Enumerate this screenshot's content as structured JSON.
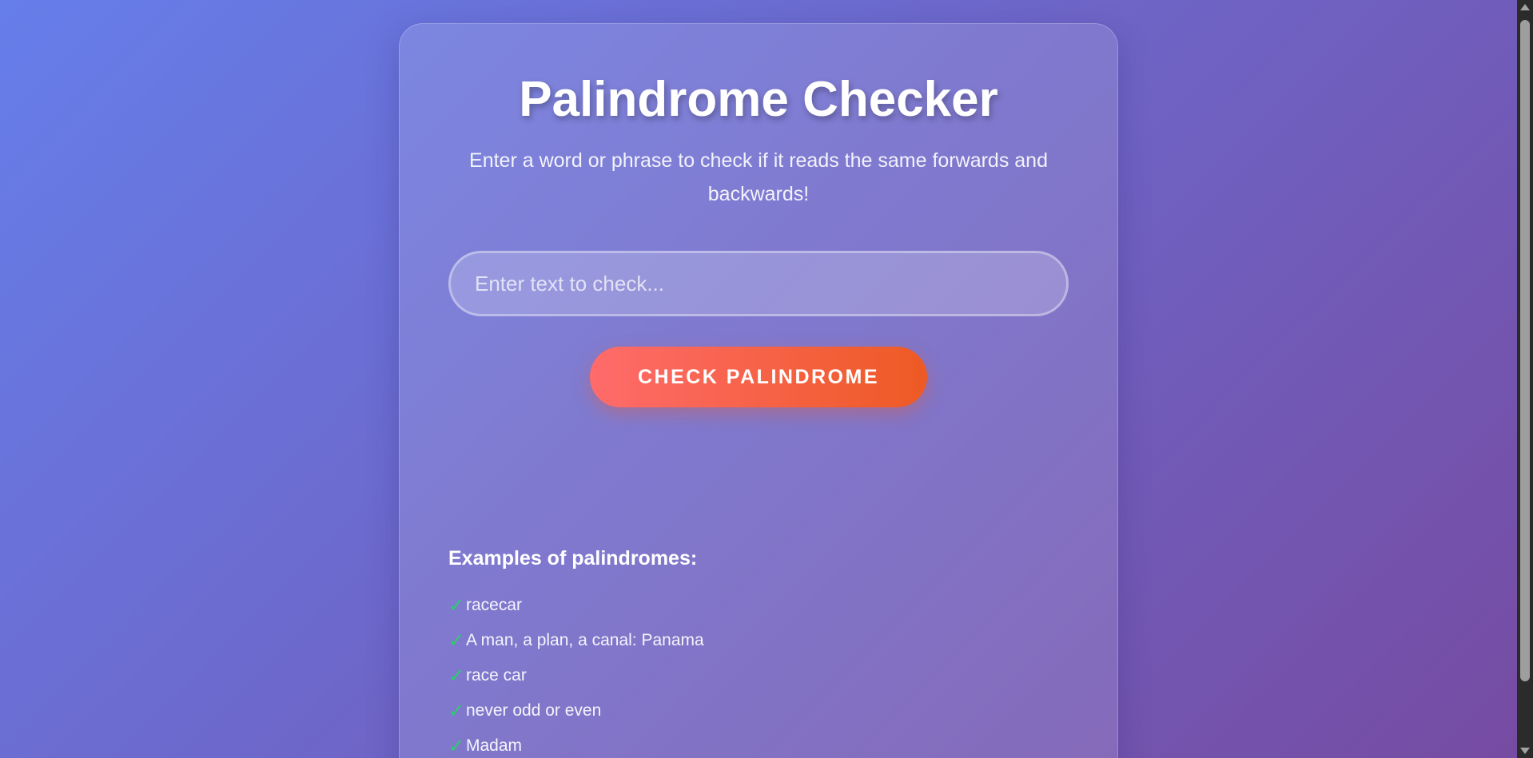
{
  "app": {
    "title": "Palindrome Checker",
    "subtitle": "Enter a word or phrase to check if it reads the same forwards and backwards!"
  },
  "input": {
    "value": "",
    "placeholder": "Enter text to check..."
  },
  "button": {
    "label": "CHECK PALINDROME"
  },
  "examples": {
    "heading": "Examples of palindromes:",
    "icon": "check-icon",
    "check_glyph": "✓",
    "items": [
      "racecar",
      "A man, a plan, a canal: Panama",
      "race car",
      "never odd or even",
      "Madam"
    ]
  },
  "colors": {
    "background_start": "#667eea",
    "background_end": "#764ba2",
    "button_start": "#ff6b6b",
    "button_end": "#ee5a24",
    "check": "#2ecc71"
  }
}
